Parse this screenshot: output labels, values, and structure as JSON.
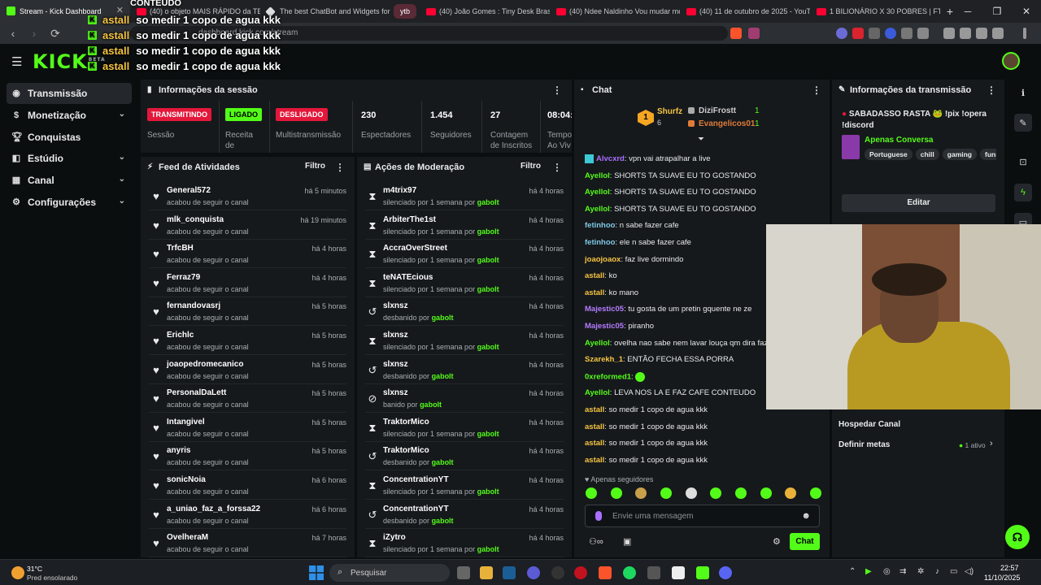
{
  "browser": {
    "tabs": [
      {
        "label": "Stream - Kick Dashboard",
        "active": true
      },
      {
        "label": "(40) o objeto MAIS RÁPIDO da TERRA",
        "active": false
      },
      {
        "label": "The best ChatBot and Widgets for Twitch",
        "active": false
      },
      {
        "label": "ytb",
        "group": true
      },
      {
        "label": "(40) João Gomes : Tiny Desk Brasil",
        "active": false
      },
      {
        "label": "(40) Ndee Naldinho Vou mudar meu",
        "active": false
      },
      {
        "label": "(40) 11 de outubro de 2025 - YouTube",
        "active": false
      },
      {
        "label": "1 BILIONÁRIO X 30 POBRES | FT. PAULO",
        "active": false
      }
    ],
    "new_tab": "+",
    "url": "dashboard.kick.com/stream"
  },
  "overlay": {
    "title": "CONTEUDO",
    "lines": [
      {
        "user": "astall",
        "text": "so medir 1 copo de agua kkk"
      },
      {
        "user": "astall",
        "text": "so medir 1 copo de agua kkk"
      },
      {
        "user": "astall",
        "text": "so medir 1 copo de agua kkk"
      },
      {
        "user": "astall",
        "text": "so medir 1 copo de agua kkk"
      }
    ]
  },
  "app": {
    "logo": "KICK",
    "logo_sup": "BETA"
  },
  "sidebar": {
    "items": [
      {
        "label": "Transmissão",
        "icon": "broadcast-icon"
      },
      {
        "label": "Monetização",
        "icon": "dollar-icon"
      },
      {
        "label": "Conquistas",
        "icon": "trophy-icon"
      },
      {
        "label": "Estúdio",
        "icon": "studio-icon"
      },
      {
        "label": "Canal",
        "icon": "channel-icon"
      },
      {
        "label": "Configurações",
        "icon": "gear-icon"
      }
    ]
  },
  "session": {
    "title": "Informações da sessão",
    "stats": [
      {
        "badge": "TRANSMITINDO",
        "label": "Sessão"
      },
      {
        "badge": "LIGADO",
        "label": "Receita de"
      },
      {
        "badge": "DESLIGADO",
        "label": "Multistransmissão"
      },
      {
        "value": "230",
        "label": "Espectadores"
      },
      {
        "value": "1.454",
        "label": "Seguidores"
      },
      {
        "value": "27",
        "label": "Contagem de Inscritos"
      },
      {
        "value": "08:04:",
        "label": "Tempo Ao Viv"
      }
    ]
  },
  "feed": {
    "title": "Feed de Atividades",
    "filter": "Filtro",
    "rows": [
      {
        "name": "General572",
        "sub": "acabou de seguir o canal",
        "time": "há 5 minutos"
      },
      {
        "name": "mlk_conquista",
        "sub": "acabou de seguir o canal",
        "time": "há 19 minutos"
      },
      {
        "name": "TrfcBH",
        "sub": "acabou de seguir o canal",
        "time": "há 4 horas"
      },
      {
        "name": "Ferraz79",
        "sub": "acabou de seguir o canal",
        "time": "há 4 horas"
      },
      {
        "name": "fernandovasrj",
        "sub": "acabou de seguir o canal",
        "time": "há 5 horas"
      },
      {
        "name": "Erichlc",
        "sub": "acabou de seguir o canal",
        "time": "há 5 horas"
      },
      {
        "name": "joaopedromecanico",
        "sub": "acabou de seguir o canal",
        "time": "há 5 horas"
      },
      {
        "name": "PersonalDaLett",
        "sub": "acabou de seguir o canal",
        "time": "há 5 horas"
      },
      {
        "name": "Intangivel",
        "sub": "acabou de seguir o canal",
        "time": "há 5 horas"
      },
      {
        "name": "anyris",
        "sub": "acabou de seguir o canal",
        "time": "há 5 horas"
      },
      {
        "name": "sonicNoia",
        "sub": "acabou de seguir o canal",
        "time": "há 6 horas"
      },
      {
        "name": "a_uniao_faz_a_forssa22",
        "sub": "acabou de seguir o canal",
        "time": "há 6 horas"
      },
      {
        "name": "OvelheraM",
        "sub": "acabou de seguir o canal",
        "time": "há 7 horas"
      }
    ]
  },
  "moderation": {
    "title": "Ações de Moderação",
    "filter": "Filtro",
    "rows": [
      {
        "name": "m4trix97",
        "sub": "silenciado por 1 semana por",
        "by": "gabolt",
        "time": "há 4 horas",
        "icon": "timeout-icon"
      },
      {
        "name": "ArbiterThe1st",
        "sub": "silenciado por 1 semana por",
        "by": "gabolt",
        "time": "há 4 horas",
        "icon": "timeout-icon"
      },
      {
        "name": "AccraOverStreet",
        "sub": "silenciado por 1 semana por",
        "by": "gabolt",
        "time": "há 4 horas",
        "icon": "timeout-icon"
      },
      {
        "name": "teNATEcious",
        "sub": "silenciado por 1 semana por",
        "by": "gabolt",
        "time": "há 4 horas",
        "icon": "timeout-icon"
      },
      {
        "name": "slxnsz",
        "sub": "desbanido por",
        "by": "gabolt",
        "time": "há 4 horas",
        "icon": "unban-icon"
      },
      {
        "name": "slxnsz",
        "sub": "silenciado por 1 semana por",
        "by": "gabolt",
        "time": "há 4 horas",
        "icon": "timeout-icon"
      },
      {
        "name": "slxnsz",
        "sub": "desbanido por",
        "by": "gabolt",
        "time": "há 4 horas",
        "icon": "unban-icon"
      },
      {
        "name": "slxnsz",
        "sub": "banido por",
        "by": "gabolt",
        "time": "há 4 horas",
        "icon": "ban-icon"
      },
      {
        "name": "TraktorMico",
        "sub": "silenciado por 1 semana por",
        "by": "gabolt",
        "time": "há 4 horas",
        "icon": "timeout-icon"
      },
      {
        "name": "TraktorMico",
        "sub": "desbanido por",
        "by": "gabolt",
        "time": "há 4 horas",
        "icon": "unban-icon"
      },
      {
        "name": "ConcentrationYT",
        "sub": "silenciado por 1 semana por",
        "by": "gabolt",
        "time": "há 4 horas",
        "icon": "timeout-icon"
      },
      {
        "name": "ConcentrationYT",
        "sub": "desbanido por",
        "by": "gabolt",
        "time": "há 4 horas",
        "icon": "unban-icon"
      },
      {
        "name": "iZytro",
        "sub": "silenciado por 1 semana por",
        "by": "gabolt",
        "time": "há 4 horas",
        "icon": "timeout-icon"
      }
    ]
  },
  "chat": {
    "title": "Chat",
    "leaderboard": {
      "rank": "1",
      "top_user": "Shurfz",
      "top_count": "6",
      "others": [
        {
          "user": "DiziFrostt",
          "count": "1"
        },
        {
          "user": "Evangelicos01",
          "count": "1"
        }
      ]
    },
    "messages": [
      {
        "user": "Alvcxrd",
        "text": ": vpn vai atrapalhar a live",
        "color": "#a970ff"
      },
      {
        "user": "Ayellol",
        "text": ": SHORTS TA SUAVE EU TO GOSTANDO",
        "color": "#53fc18"
      },
      {
        "user": "Ayellol",
        "text": ": SHORTS TA SUAVE EU TO GOSTANDO",
        "color": "#53fc18"
      },
      {
        "user": "Ayellol",
        "text": ": SHORTS TA SUAVE EU TO GOSTANDO",
        "color": "#53fc18"
      },
      {
        "user": "fetinhoo",
        "text": ": n sabe fazer cafe",
        "color": "#7ec8e3"
      },
      {
        "user": "fetinhoo",
        "text": ": ele n sabe fazer cafe",
        "color": "#7ec8e3"
      },
      {
        "user": "joaojoaox",
        "text": ": faz live dormindo",
        "color": "#f5c542"
      },
      {
        "user": "astall",
        "text": ": ko",
        "color": "#f5c542"
      },
      {
        "user": "astall",
        "text": ": ko mano",
        "color": "#f5c542"
      },
      {
        "user": "Majestic05",
        "text": ": tu gosta de um pretin gquente ne ze",
        "color": "#b57cff"
      },
      {
        "user": "Majestic05",
        "text": ": piranho",
        "color": "#b57cff"
      },
      {
        "user": "Ayellol",
        "text": ": ovelha nao sabe nem lavar louça qm dira fazer",
        "color": "#53fc18"
      },
      {
        "user": "Szarekh_1",
        "text": ": ENTÃO FECHA ESSA PORRA",
        "color": "#f5c542"
      },
      {
        "user": "0xreformed1",
        "text": ":",
        "color": "#53fc18"
      },
      {
        "user": "Ayellol",
        "text": ": LEVA NOS LA E FAZ CAFE CONTEUDO",
        "color": "#53fc18"
      },
      {
        "user": "astall",
        "text": ": so medir 1 copo de agua kkk",
        "color": "#f5c542"
      },
      {
        "user": "astall",
        "text": ": so medir 1 copo de agua kkk",
        "color": "#f5c542"
      },
      {
        "user": "astall",
        "text": ": so medir 1 copo de agua kkk",
        "color": "#f5c542"
      },
      {
        "user": "astall",
        "text": ": so medir 1 copo de agua kkk",
        "color": "#f5c542"
      }
    ],
    "followers_only": "Apenas seguidores",
    "input_placeholder": "Envie uma mensagem",
    "send_label": "Chat"
  },
  "stream_info": {
    "title": "Informações da transmissão",
    "stream_title": "SABADASSO RASTA 🐸 !pix !opera !discord",
    "category": "Apenas Conversa",
    "tags": [
      "Portuguese",
      "chill",
      "gaming",
      "funny"
    ],
    "edit_label": "Editar",
    "host_label": "Hospedar Canal",
    "goals_label": "Definir metas",
    "goals_status": "1 ativo"
  },
  "taskbar": {
    "weather_temp": "31°C",
    "weather_desc": "Pred ensolarado",
    "search_label": "Pesquisar",
    "time": "22:57",
    "date": "11/10/2025"
  },
  "colors": {
    "accent": "#53fc18",
    "live": "#e3173a",
    "panel": "#16191c",
    "bg": "#0b0e0f"
  }
}
